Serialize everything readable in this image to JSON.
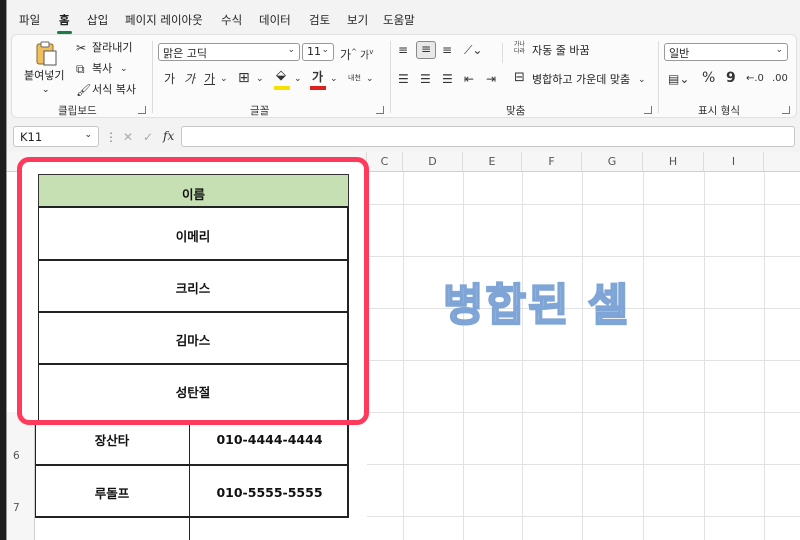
{
  "menu_tabs": [
    "파일",
    "홈",
    "삽입",
    "페이지 레이아웃",
    "수식",
    "데이터",
    "검토",
    "보기",
    "도움말"
  ],
  "clipboard": {
    "paste": "붙여넣기",
    "cut": "잘라내기",
    "copy": "복사",
    "format_painter": "서식 복사",
    "label": "클립보드"
  },
  "font": {
    "name": "맑은 고딕",
    "size": "11",
    "grow": "가",
    "shrink": "가",
    "bold": "가",
    "italic": "가",
    "underline": "가",
    "font_color_glyph": "가",
    "phonetic": "내천",
    "label": "글꼴",
    "fill_color": "#f5e100",
    "text_color": "#e02020"
  },
  "alignment": {
    "wrap": "자동 줄 바꿈",
    "merge": "병합하고 가운데 맞춤",
    "wrap_icon": "가나다라",
    "label": "맞춤"
  },
  "number": {
    "format": "일반",
    "percent": "%",
    "comma": "9",
    "label": "표시 형식"
  },
  "name_box": "K11",
  "formula_icons": {
    "cancel": "✕",
    "enter": "✓",
    "fx": "fx"
  },
  "columns": [
    "C",
    "D",
    "E",
    "F",
    "G",
    "H",
    "I"
  ],
  "rows": [
    "6",
    "7"
  ],
  "watermark": "병합된 셀",
  "popup_header": "이름",
  "popup_names": [
    "이메리",
    "크리스",
    "김마스",
    "성탄절"
  ],
  "lower_rows": [
    {
      "name": "장산타",
      "phone": "010-4444-4444"
    },
    {
      "name": "루돌프",
      "phone": "010-5555-5555"
    }
  ],
  "colors": {
    "accent": "#1a7f46",
    "highlight": "#ff3a5c",
    "header_fill": "#c6e0b4"
  }
}
